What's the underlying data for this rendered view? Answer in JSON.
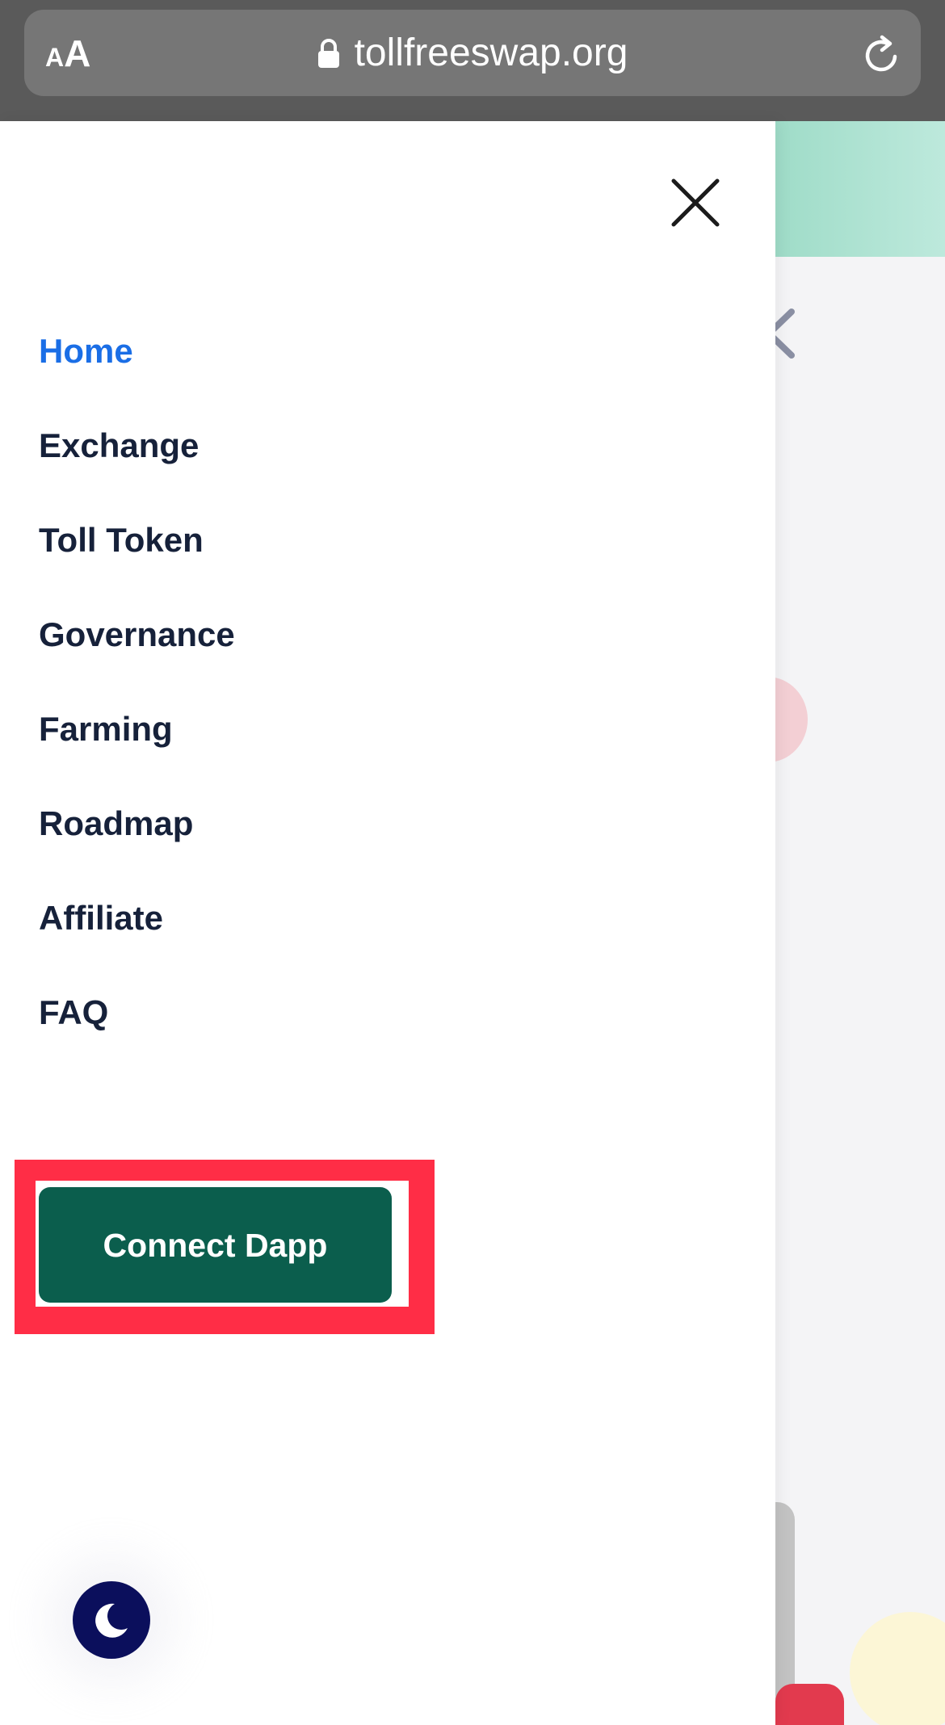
{
  "browser": {
    "text_size_small": "A",
    "text_size_large": "A",
    "url": "tollfreeswap.org",
    "icons": {
      "lock": "lock-icon",
      "reload": "reload-icon"
    }
  },
  "drawer": {
    "nav_items": [
      {
        "label": "Home",
        "active": true
      },
      {
        "label": "Exchange",
        "active": false
      },
      {
        "label": "Toll Token",
        "active": false
      },
      {
        "label": "Governance",
        "active": false
      },
      {
        "label": "Farming",
        "active": false
      },
      {
        "label": "Roadmap",
        "active": false
      },
      {
        "label": "Affiliate",
        "active": false
      },
      {
        "label": "FAQ",
        "active": false
      }
    ],
    "connect_button_label": "Connect Dapp",
    "icons": {
      "close": "close-icon",
      "theme": "moon-icon"
    }
  },
  "colors": {
    "active_nav": "#1a6ee6",
    "nav_text": "#16213a",
    "connect_button": "#0b5e4d",
    "highlight": "#ff2d46",
    "theme_toggle": "#0b0f5c"
  }
}
